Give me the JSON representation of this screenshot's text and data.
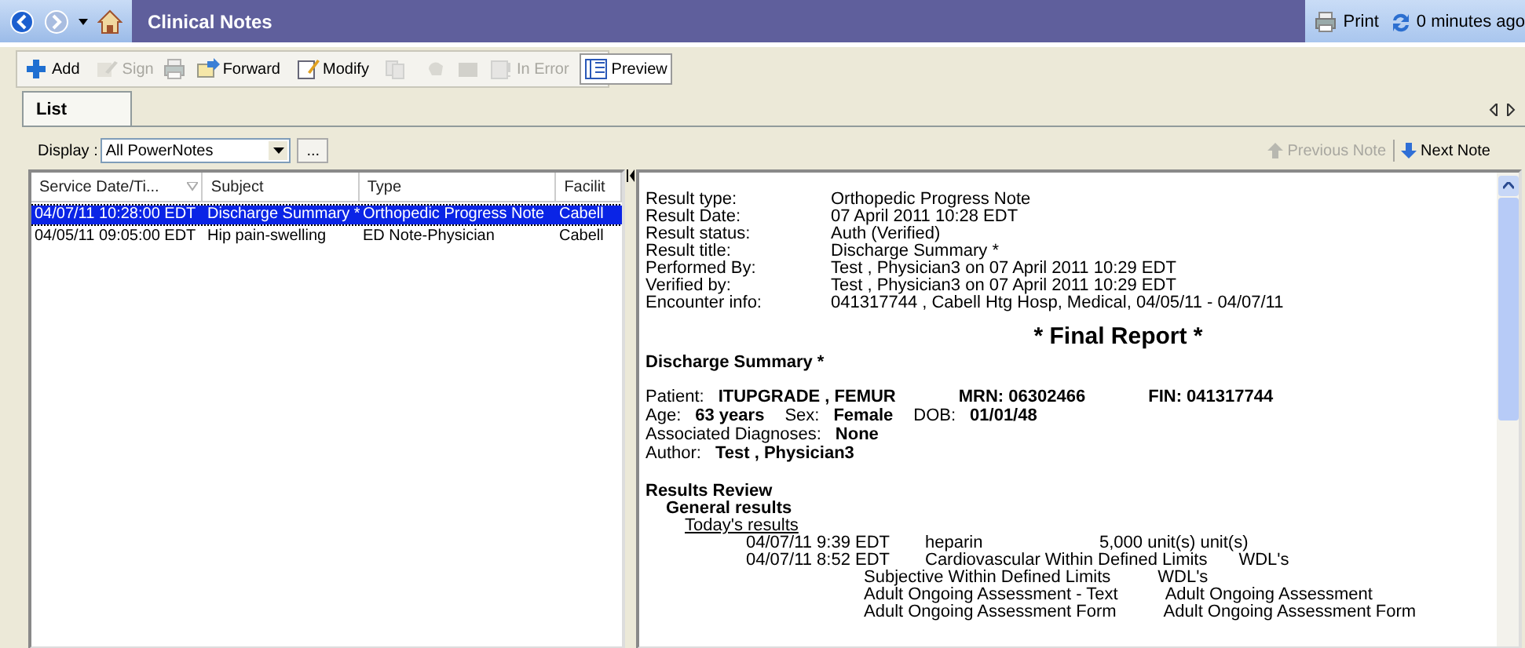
{
  "title_bar": {
    "title": "Clinical Notes",
    "actions": [
      {
        "label": "Print"
      },
      {
        "label": "0 minutes ago"
      }
    ]
  },
  "toolbar": [
    {
      "label": "Add",
      "disabled": false,
      "pressed": false
    },
    {
      "label": "Sign",
      "disabled": true,
      "pressed": false
    },
    {
      "disabled": true,
      "pressed": false
    },
    {
      "label": "Forward",
      "disabled": false,
      "pressed": false
    },
    {
      "label": "Modify",
      "disabled": false,
      "pressed": false
    },
    {
      "disabled": true,
      "pressed": false
    },
    {
      "disabled": true,
      "pressed": false
    },
    {
      "disabled": true,
      "pressed": false
    },
    {
      "label": "In Error",
      "disabled": true,
      "pressed": false
    },
    {
      "label": "Preview",
      "disabled": false,
      "pressed": true
    }
  ],
  "tabs": [
    {
      "label": "List",
      "selected": true
    }
  ],
  "display": {
    "label": "Display :",
    "value": "All PowerNotes",
    "more": "..."
  },
  "note_nav": [
    {
      "label": "Previous Note",
      "disabled": true
    },
    {
      "label": "Next Note",
      "disabled": false
    }
  ],
  "table": {
    "columns": [
      "Service Date/Ti...",
      "Subject",
      "Type",
      "Facilit"
    ],
    "rows": [
      {
        "cells": [
          "04/07/11 10:28:00 EDT",
          "Discharge Summary *",
          "Orthopedic Progress Note",
          "Cabell"
        ],
        "selected": true
      },
      {
        "cells": [
          "04/05/11 09:05:00 EDT",
          "Hip pain-swelling",
          "ED Note-Physician",
          "Cabell"
        ],
        "selected": false
      }
    ]
  },
  "preview": {
    "header": [
      {
        "label": "Result type:",
        "value": "Orthopedic Progress Note"
      },
      {
        "label": "Result Date:",
        "value": "07 April 2011 10:28 EDT"
      },
      {
        "label": "Result status:",
        "value": "Auth (Verified)"
      },
      {
        "label": "Result title:",
        "value": "Discharge Summary *"
      },
      {
        "label": "Performed By:",
        "value": "Test , Physician3 on 07 April 2011 10:29 EDT"
      },
      {
        "label": "Verified by:",
        "value": "Test , Physician3 on 07 April 2011 10:29 EDT"
      },
      {
        "label": "Encounter info:",
        "value": "041317744 , Cabell Htg Hosp, Medical, 04/05/11 - 04/07/11"
      }
    ],
    "report_title": "* Final Report *",
    "document_title": "Discharge Summary *",
    "demographics": [
      [
        {
          "label": "Patient:",
          "value": "ITUPGRADE , FEMUR"
        },
        {
          "value": "MRN: 06302466"
        },
        {
          "value": "FIN: 041317744"
        }
      ],
      [
        {
          "label": "Age:",
          "value": "63 years"
        },
        {
          "label": "Sex:",
          "value": "Female"
        },
        {
          "label": "DOB:",
          "value": "01/01/48"
        }
      ],
      [
        {
          "label": "Associated Diagnoses:",
          "value": "None"
        }
      ],
      [
        {
          "label": "Author:",
          "value": "Test , Physician3"
        }
      ]
    ],
    "results": {
      "title": "Results Review",
      "children": [
        {
          "title": "General results",
          "children": [
            {
              "title": "Today's results",
              "entries": [
                {
                  "date": "04/07/11 9:39 EDT",
                  "name": "heparin",
                  "value": "5,000 unit(s) unit(s)"
                },
                {
                  "date": "04/07/11 8:52 EDT",
                  "name": "Cardiovascular Within Defined Limits",
                  "value": "WDL's"
                },
                {
                  "name": "Subjective Within Defined Limits",
                  "value": "WDL's"
                },
                {
                  "name": "Adult Ongoing Assessment - Text",
                  "value": "Adult Ongoing Assessment"
                },
                {
                  "name": "Adult Ongoing Assessment Form",
                  "value": "Adult Ongoing Assessment Form"
                }
              ]
            }
          ]
        }
      ]
    }
  }
}
